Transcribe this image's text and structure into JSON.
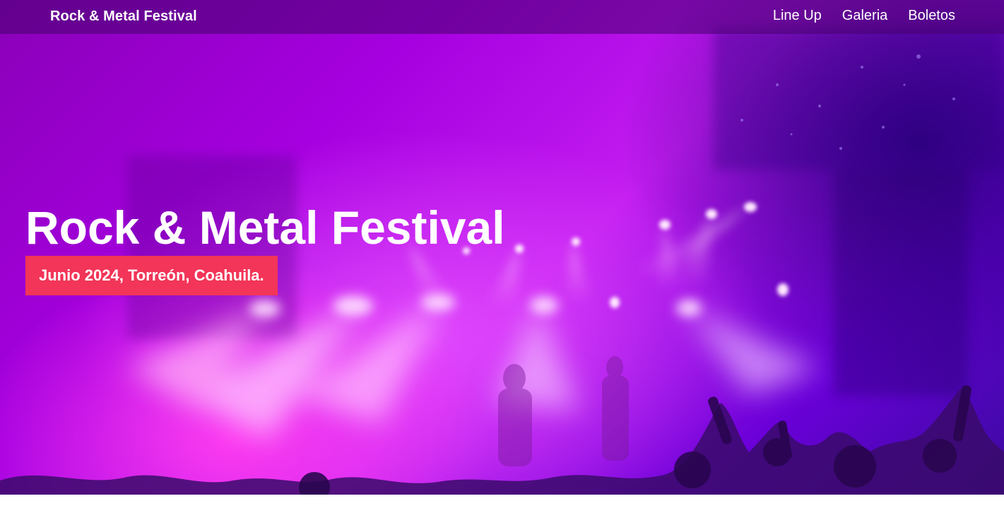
{
  "navbar": {
    "brand": "Rock & Metal Festival",
    "links": [
      {
        "label": "Line Up"
      },
      {
        "label": "Galeria"
      },
      {
        "label": "Boletos"
      }
    ]
  },
  "hero": {
    "title": "Rock & Metal Festival",
    "subtitle": "Junio 2024, Torreón, Coahuila.",
    "background_image": "concert-stage-lights",
    "badge_color": "#f23558"
  },
  "colors": {
    "navbar_bg": "#4a0070",
    "hero_magenta": "#e21cf0",
    "hero_purple": "#6a00d8",
    "text": "#ffffff"
  }
}
